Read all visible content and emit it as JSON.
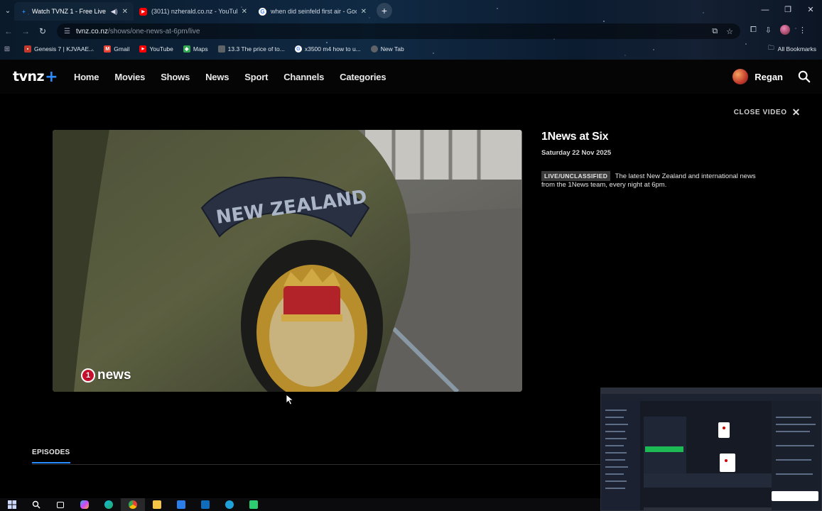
{
  "browser": {
    "tabs": [
      {
        "title": "Watch TVNZ 1 - Free Live T",
        "favicon": "tvnz-plus-icon",
        "active": true,
        "audio": true
      },
      {
        "title": "(3011) nzherald.co.nz - YouTub",
        "favicon": "youtube-icon",
        "active": false
      },
      {
        "title": "when did seinfeld first air - Goo",
        "favicon": "google-icon",
        "active": false
      }
    ],
    "url_host": "tvnz.co.nz",
    "url_path": "/shows/one-news-at-6pm/live",
    "bookmarks": [
      {
        "label": "Genesis 7 | KJVAAE...",
        "icon": "bookmark-red-icon",
        "color": "#c0392b"
      },
      {
        "label": "Gmail",
        "icon": "gmail-icon",
        "color": "#ea4335"
      },
      {
        "label": "YouTube",
        "icon": "youtube-icon",
        "color": "#ff0000"
      },
      {
        "label": "Maps",
        "icon": "maps-icon",
        "color": "#34a853"
      },
      {
        "label": "13.3 The price of to...",
        "icon": "page-icon",
        "color": "#5f6368"
      },
      {
        "label": "x3500 m4 how to u...",
        "icon": "google-icon",
        "color": "#4285f4"
      },
      {
        "label": "New Tab",
        "icon": "newtab-icon",
        "color": "#5f6368"
      }
    ],
    "all_bookmarks": "All Bookmarks"
  },
  "site": {
    "logo_text": "tvnz",
    "logo_plus": "+",
    "nav": [
      "Home",
      "Movies",
      "Shows",
      "News",
      "Sport",
      "Channels",
      "Categories"
    ],
    "user_name": "Regan",
    "close_video": "CLOSE VIDEO",
    "accent": "#2a8cff"
  },
  "show": {
    "title": "1News at Six",
    "date": "Saturday 22 Nov 2025",
    "rating": "LIVE/UNCLASSIFIED",
    "description": "The latest New Zealand and international news from the 1News team, every night at 6pm."
  },
  "player": {
    "bug_number": "1",
    "bug_text": "news",
    "patch_text": "NEW ZEALAND"
  },
  "episodes_tab": "EPISODES",
  "taskbar_icons": [
    "windows-start-icon",
    "search-icon",
    "task-view-icon",
    "copilot-icon",
    "edge-icon",
    "chrome-icon",
    "file-explorer-icon",
    "store-icon",
    "outlook-icon",
    "app-icon",
    "terminal-icon"
  ]
}
